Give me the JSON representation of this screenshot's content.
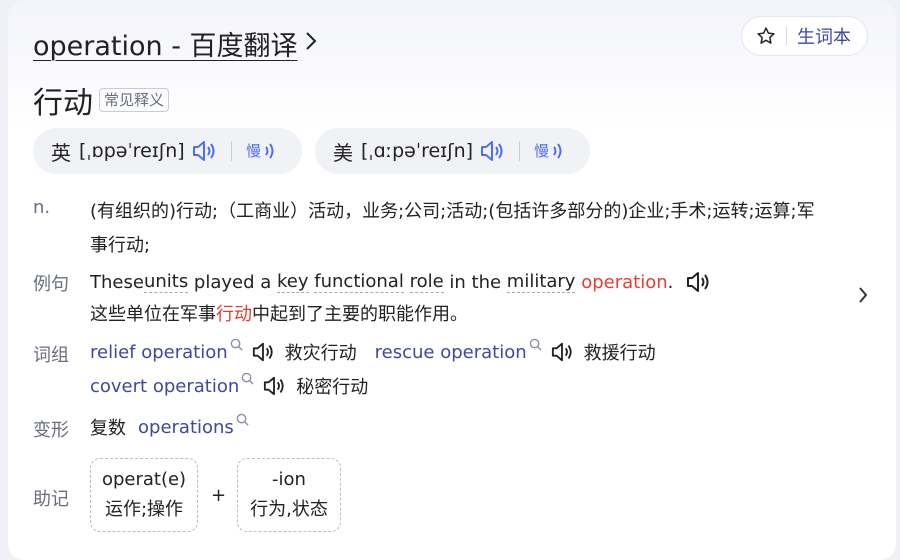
{
  "header": {
    "title": "operation - 百度翻译",
    "vocab_button_label": "生词本"
  },
  "headword": {
    "translation": "行动",
    "tag": "常见释义"
  },
  "pronunciations": [
    {
      "region": "英",
      "phonetic": "[ˌɒpəˈreɪʃn]"
    },
    {
      "region": "美",
      "phonetic": "[ˌɑːpəˈreɪʃn]"
    }
  ],
  "definition": {
    "pos": "n.",
    "line1": "(有组织的)行动;（工商业）活动，业务;公司;活动;(包括许多部分的)企业;手术;运转;运算;军",
    "line2": "事行动;"
  },
  "example": {
    "label": "例句",
    "en_parts": [
      "These ",
      "units",
      " played a ",
      "key",
      " ",
      "functional",
      " ",
      "role",
      " in the ",
      "military",
      " ",
      "operation",
      "."
    ],
    "zh_before": "这些单位在军事",
    "zh_highlight": "行动",
    "zh_after": "中起到了主要的职能作用。"
  },
  "phrases": {
    "label": "词组",
    "items": [
      {
        "en": "relief operation",
        "zh": "救灾行动"
      },
      {
        "en": "rescue operation",
        "zh": "救援行动"
      },
      {
        "en": "covert operation",
        "zh": "秘密行动"
      }
    ]
  },
  "inflection": {
    "label": "变形",
    "kind": "复数",
    "word": "operations"
  },
  "mnemonic": {
    "label": "助记",
    "parts": [
      {
        "root": "operat(e)",
        "meaning": "运作;操作"
      },
      {
        "root": "-ion",
        "meaning": "行为,状态"
      }
    ],
    "plus": "+"
  },
  "icons": {
    "star": "star-icon",
    "speaker": "speaker-icon",
    "slow": "slow-speaker-icon",
    "search": "search-icon",
    "chevron": "chevron-right-icon"
  },
  "colors": {
    "accent_link": "#3c4a9c",
    "speaker": "#4e6ef2",
    "highlight_red": "#e33e33"
  }
}
